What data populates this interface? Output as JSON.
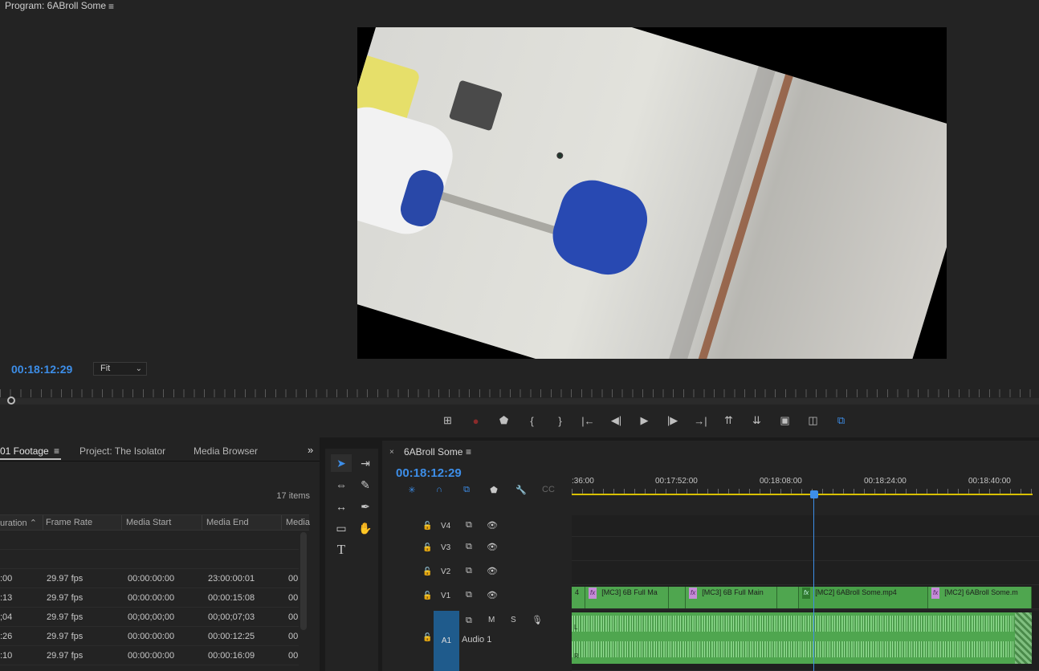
{
  "monitor": {
    "title": "Program: 6ABroll Some",
    "menu_icon": "≡",
    "timecode": "00:18:12:29",
    "fit": "Fit"
  },
  "transport": [
    {
      "icon": "safe-margins-icon",
      "glyph": "⊞"
    },
    {
      "icon": "record-icon",
      "glyph": "●"
    },
    {
      "icon": "add-marker-icon",
      "glyph": "⬟"
    },
    {
      "icon": "mark-in-icon",
      "glyph": "{"
    },
    {
      "icon": "mark-out-icon",
      "glyph": "}"
    },
    {
      "icon": "go-to-in-icon",
      "glyph": "|←"
    },
    {
      "icon": "step-back-icon",
      "glyph": "◀|"
    },
    {
      "icon": "play-icon",
      "glyph": "▶"
    },
    {
      "icon": "step-forward-icon",
      "glyph": "|▶"
    },
    {
      "icon": "go-to-out-icon",
      "glyph": "→|"
    },
    {
      "icon": "lift-icon",
      "glyph": "⇈"
    },
    {
      "icon": "extract-icon",
      "glyph": "⇊"
    },
    {
      "icon": "export-frame-icon",
      "glyph": "▣"
    },
    {
      "icon": "comparison-view-icon",
      "glyph": "◫"
    },
    {
      "icon": "proxy-toggle-icon",
      "glyph": "⧉"
    }
  ],
  "project": {
    "tabs": [
      "01 Footage",
      "Project: The Isolator",
      "Media Browser"
    ],
    "more": "»",
    "items_count": "17 items",
    "columns": [
      "uration",
      "Frame Rate",
      "Media Start",
      "Media End",
      "Media"
    ],
    "rows": [
      {
        "duration": "",
        "fps": "",
        "start": "",
        "end": "",
        "extra": ""
      },
      {
        "duration": "",
        "fps": "",
        "start": "",
        "end": "",
        "extra": ""
      },
      {
        "duration": ":00",
        "fps": "29.97 fps",
        "start": "00:00:00:00",
        "end": "23:00:00:01",
        "extra": "00"
      },
      {
        "duration": ":13",
        "fps": "29.97 fps",
        "start": "00:00:00:00",
        "end": "00:00:15:08",
        "extra": "00"
      },
      {
        "duration": ";04",
        "fps": "29.97 fps",
        "start": "00;00;00;00",
        "end": "00;00;07;03",
        "extra": "00"
      },
      {
        "duration": ":26",
        "fps": "29.97 fps",
        "start": "00:00:00:00",
        "end": "00:00:12:25",
        "extra": "00"
      },
      {
        "duration": ":10",
        "fps": "29.97 fps",
        "start": "00:00:00:00",
        "end": "00:00:16:09",
        "extra": "00"
      }
    ]
  },
  "timeline": {
    "title": "6ABroll Some",
    "close": "×",
    "menu_icon": "≡",
    "timecode": "00:18:12:29",
    "ruler_labels": [
      ":36:00",
      "00:17:52:00",
      "00:18:08:00",
      "00:18:24:00",
      "00:18:40:00"
    ],
    "tracks": [
      "V4",
      "V3",
      "V2",
      "V1"
    ],
    "audio_track": {
      "id": "A1",
      "name": "Audio 1",
      "m": "M",
      "s": "S"
    },
    "clips": [
      {
        "label": "4"
      },
      {
        "label": "[MC3] 6B Full Ma"
      },
      {
        "label": ""
      },
      {
        "label": "[MC3] 6B Full Main"
      },
      {
        "label": ""
      },
      {
        "label": "[MC2] 6ABroll Some.mp4"
      },
      {
        "label": "[MC2] 6ABroll Some.m"
      }
    ],
    "fx": "fx",
    "audio_l": "L",
    "audio_r": "R"
  }
}
